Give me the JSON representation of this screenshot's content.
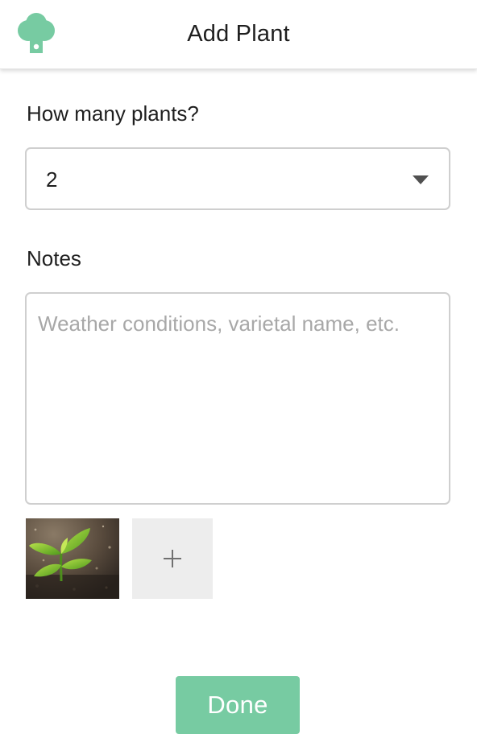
{
  "header": {
    "title": "Add Plant",
    "logo_icon": "tree-icon",
    "logo_color": "#77cba2"
  },
  "form": {
    "count_label": "How many plants?",
    "count_value": "2",
    "notes_label": "Notes",
    "notes_value": "",
    "notes_placeholder": "Weather conditions, varietal name, etc."
  },
  "photos": {
    "items": [
      {
        "alt": "plant seedling photo"
      }
    ],
    "add_icon": "plus-icon"
  },
  "actions": {
    "done_label": "Done",
    "accent_color": "#77cba2"
  }
}
